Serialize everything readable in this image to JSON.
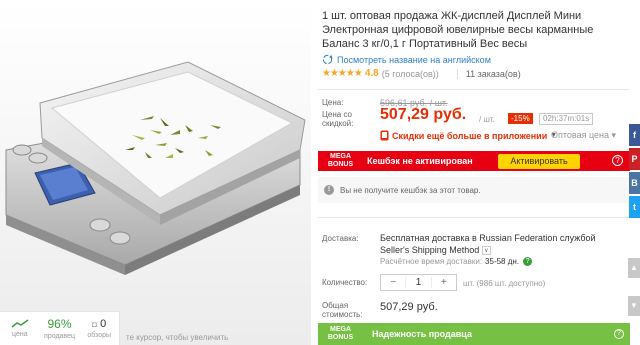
{
  "product": {
    "title": "1 шт. оптовая продажа ЖК-дисплей Дисплей Мини Электронная цифровой ювелирные весы карманные Баланс 3 кг/0,1 г Портативный Вес весы",
    "translate_link": "Посмотреть название на английском",
    "rating_stars": "★★★★★",
    "rating_score": "4.8",
    "rating_votes": "(5 голоса(ов))",
    "orders": "11 заказа(ов)"
  },
  "price": {
    "label": "Цена:",
    "old_value": "596,61 руб. / шт.",
    "discount_label": "Цена со скидкой:",
    "value": "507,29 руб.",
    "unit": "/ шт.",
    "discount": "-15%",
    "timer": "02h:37m:01s",
    "app_promo": "Скидки ещё больше в приложении",
    "app_caret": "▼",
    "wholesale": "Оптовая цена ▾"
  },
  "cashback": {
    "mega": "MEGA",
    "bonus": "BONUS",
    "text": "Кешбэк не активирован",
    "button": "Активировать",
    "help": "?"
  },
  "notice": {
    "icon": "!",
    "text": "Вы не получите кешбэк за этот товар."
  },
  "shipping": {
    "label": "Доставка:",
    "text": "Бесплатная доставка в Russian Federation службой Seller's Shipping Method",
    "caret": "∨",
    "est_label": "Расчётное время доставки:",
    "est_value": "35-58 дн.",
    "est_icon": "?"
  },
  "quantity": {
    "label": "Количество:",
    "minus": "−",
    "value": "1",
    "plus": "+",
    "available": "шт. (986 шт. доступно)"
  },
  "total": {
    "label_line1": "Общая",
    "label_line2": "стоимость:",
    "value": "507,29 руб."
  },
  "trust": {
    "mega": "MEGA",
    "bonus": "BONUS",
    "text": "Надежность продавца",
    "help": "?"
  },
  "gallery": {
    "stat_price_label": "цена",
    "stat_sellers_value": "96%",
    "stat_sellers_label": "продавец",
    "stat_reviews_value": "0",
    "stat_reviews_label": "обзоры",
    "zoom_hint": "те курсор, чтобы увеличить"
  },
  "social": {
    "items": [
      {
        "name": "facebook",
        "glyph": "f",
        "color": "#3b5998"
      },
      {
        "name": "pinterest",
        "glyph": "P",
        "color": "#cb2027"
      },
      {
        "name": "vk",
        "glyph": "B",
        "color": "#4c75a3"
      },
      {
        "name": "twitter",
        "glyph": "t",
        "color": "#1da1f2"
      }
    ],
    "scroll_up": "▲",
    "scroll_down": "▼"
  },
  "colors": {
    "accent_red": "#e62e04",
    "cashback_red": "#e60012",
    "trust_green": "#76c043",
    "star": "#f6a623",
    "link_blue": "#2f80c7"
  }
}
